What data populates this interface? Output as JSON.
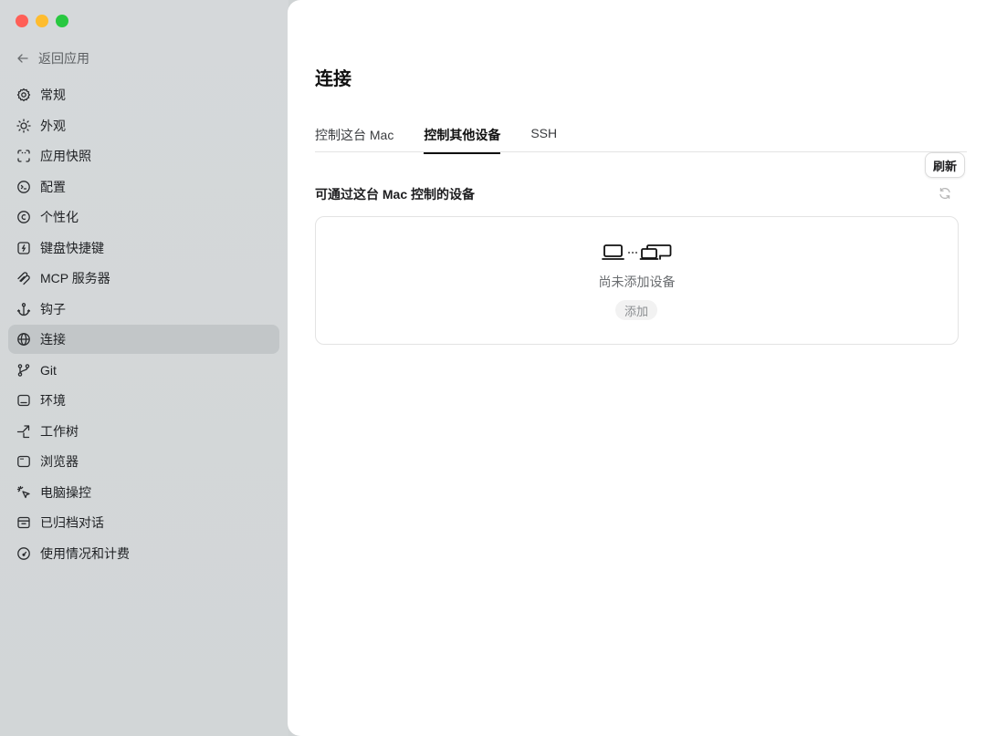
{
  "window": {
    "traffic_lights": [
      "#ff5f57",
      "#febc2e",
      "#28c840"
    ]
  },
  "sidebar": {
    "back_label": "返回应用",
    "items": [
      {
        "label": "常规",
        "icon": "gear-icon"
      },
      {
        "label": "外观",
        "icon": "sun-icon"
      },
      {
        "label": "应用快照",
        "icon": "snapshot-icon"
      },
      {
        "label": "配置",
        "icon": "terminal-icon"
      },
      {
        "label": "个性化",
        "icon": "personalize-icon"
      },
      {
        "label": "键盘快捷键",
        "icon": "keyboard-shortcut-icon"
      },
      {
        "label": "MCP 服务器",
        "icon": "mcp-icon"
      },
      {
        "label": "钩子",
        "icon": "anchor-icon"
      },
      {
        "label": "连接",
        "icon": "globe-icon",
        "active": true
      },
      {
        "label": "Git",
        "icon": "git-branch-icon"
      },
      {
        "label": "环境",
        "icon": "environment-icon"
      },
      {
        "label": "工作树",
        "icon": "worktree-icon"
      },
      {
        "label": "浏览器",
        "icon": "browser-icon"
      },
      {
        "label": "电脑操控",
        "icon": "computer-use-icon"
      },
      {
        "label": "已归档对话",
        "icon": "archive-icon"
      },
      {
        "label": "使用情况和计费",
        "icon": "gauge-icon"
      }
    ]
  },
  "main": {
    "title": "连接",
    "tabs": [
      {
        "label": "控制这台 Mac",
        "active": false
      },
      {
        "label": "控制其他设备",
        "active": true
      },
      {
        "label": "SSH",
        "active": false
      }
    ],
    "refresh_label": "刷新",
    "section_title": "可通过这台 Mac 控制的设备",
    "empty_icon": "devices-icon",
    "empty_text": "尚未添加设备",
    "add_label": "添加"
  }
}
